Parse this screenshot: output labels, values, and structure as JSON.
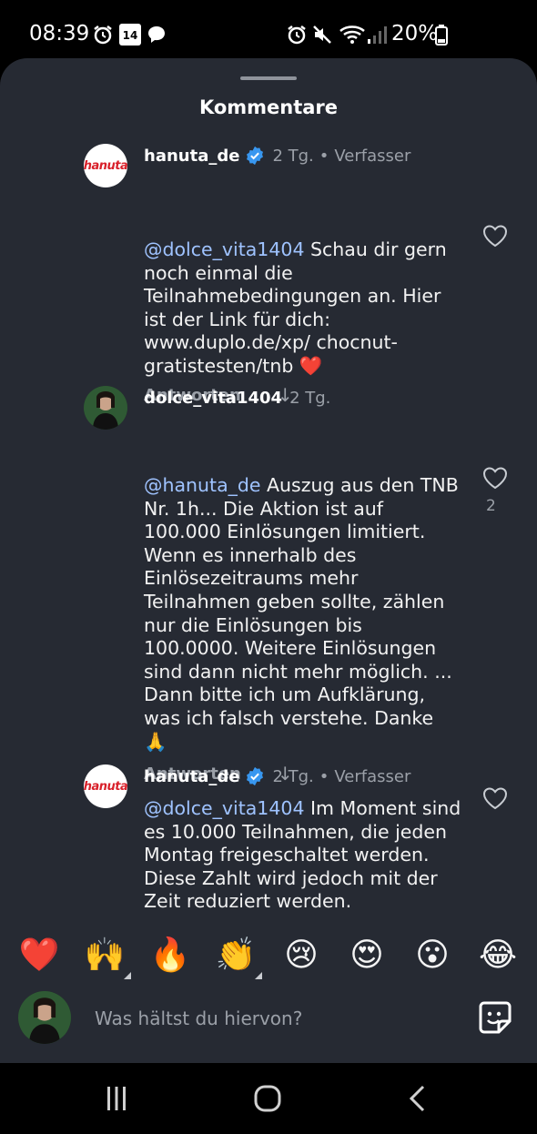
{
  "status_bar": {
    "time": "08:39",
    "calendar_day": "14",
    "battery": "20%"
  },
  "sheet": {
    "title": "Kommentare"
  },
  "comments": [
    {
      "username": "hanuta_de",
      "avatar_text": "hanuta",
      "verified": true,
      "time": "2 Tg.",
      "author_label": "Verfasser",
      "mention": "@dolce_vita1404",
      "text": " Schau dir gern noch einmal die Teilnahmebedingungen an. Hier ist der Link für dich: www.duplo.de/xp/ chocnut-gratistesten/tnb ❤️",
      "reply_label": "Antworten",
      "likes": ""
    },
    {
      "username": "dolce_vita1404",
      "verified": false,
      "time": "2 Tg.",
      "author_label": "",
      "mention": "@hanuta_de",
      "text": " Auszug aus den TNB Nr. 1h... Die Aktion ist auf 100.000 Einlösungen limitiert. Wenn es innerhalb des Einlösezeitraums mehr Teilnahmen geben sollte, zählen nur die Einlösungen bis 100.0000. Weitere Einlösungen sind dann nicht mehr möglich. ... Dann bitte ich um Aufklärung, was ich falsch verstehe. Danke 🙏",
      "reply_label": "Antworten",
      "likes": "2"
    },
    {
      "username": "hanuta_de",
      "avatar_text": "hanuta",
      "verified": true,
      "time": "2 Tg.",
      "author_label": "Verfasser",
      "mention": "@dolce_vita1404",
      "text": " Im Moment sind es 10.000 Teilnahmen, die jeden Montag freigeschaltet werden. Diese Zahlt wird jedoch mit der Zeit reduziert werden.",
      "reply_label": "",
      "likes": ""
    }
  ],
  "emoji_bar": [
    "❤️",
    "🙌",
    "🔥",
    "👏",
    "😢",
    "😍",
    "😮",
    "😂"
  ],
  "composer": {
    "placeholder": "Was hältst du hiervon?"
  },
  "colors": {
    "sheet_bg": "#262a33",
    "mention": "#9fc3ff",
    "verified": "#3897f0",
    "muted": "#9ba0a8"
  }
}
